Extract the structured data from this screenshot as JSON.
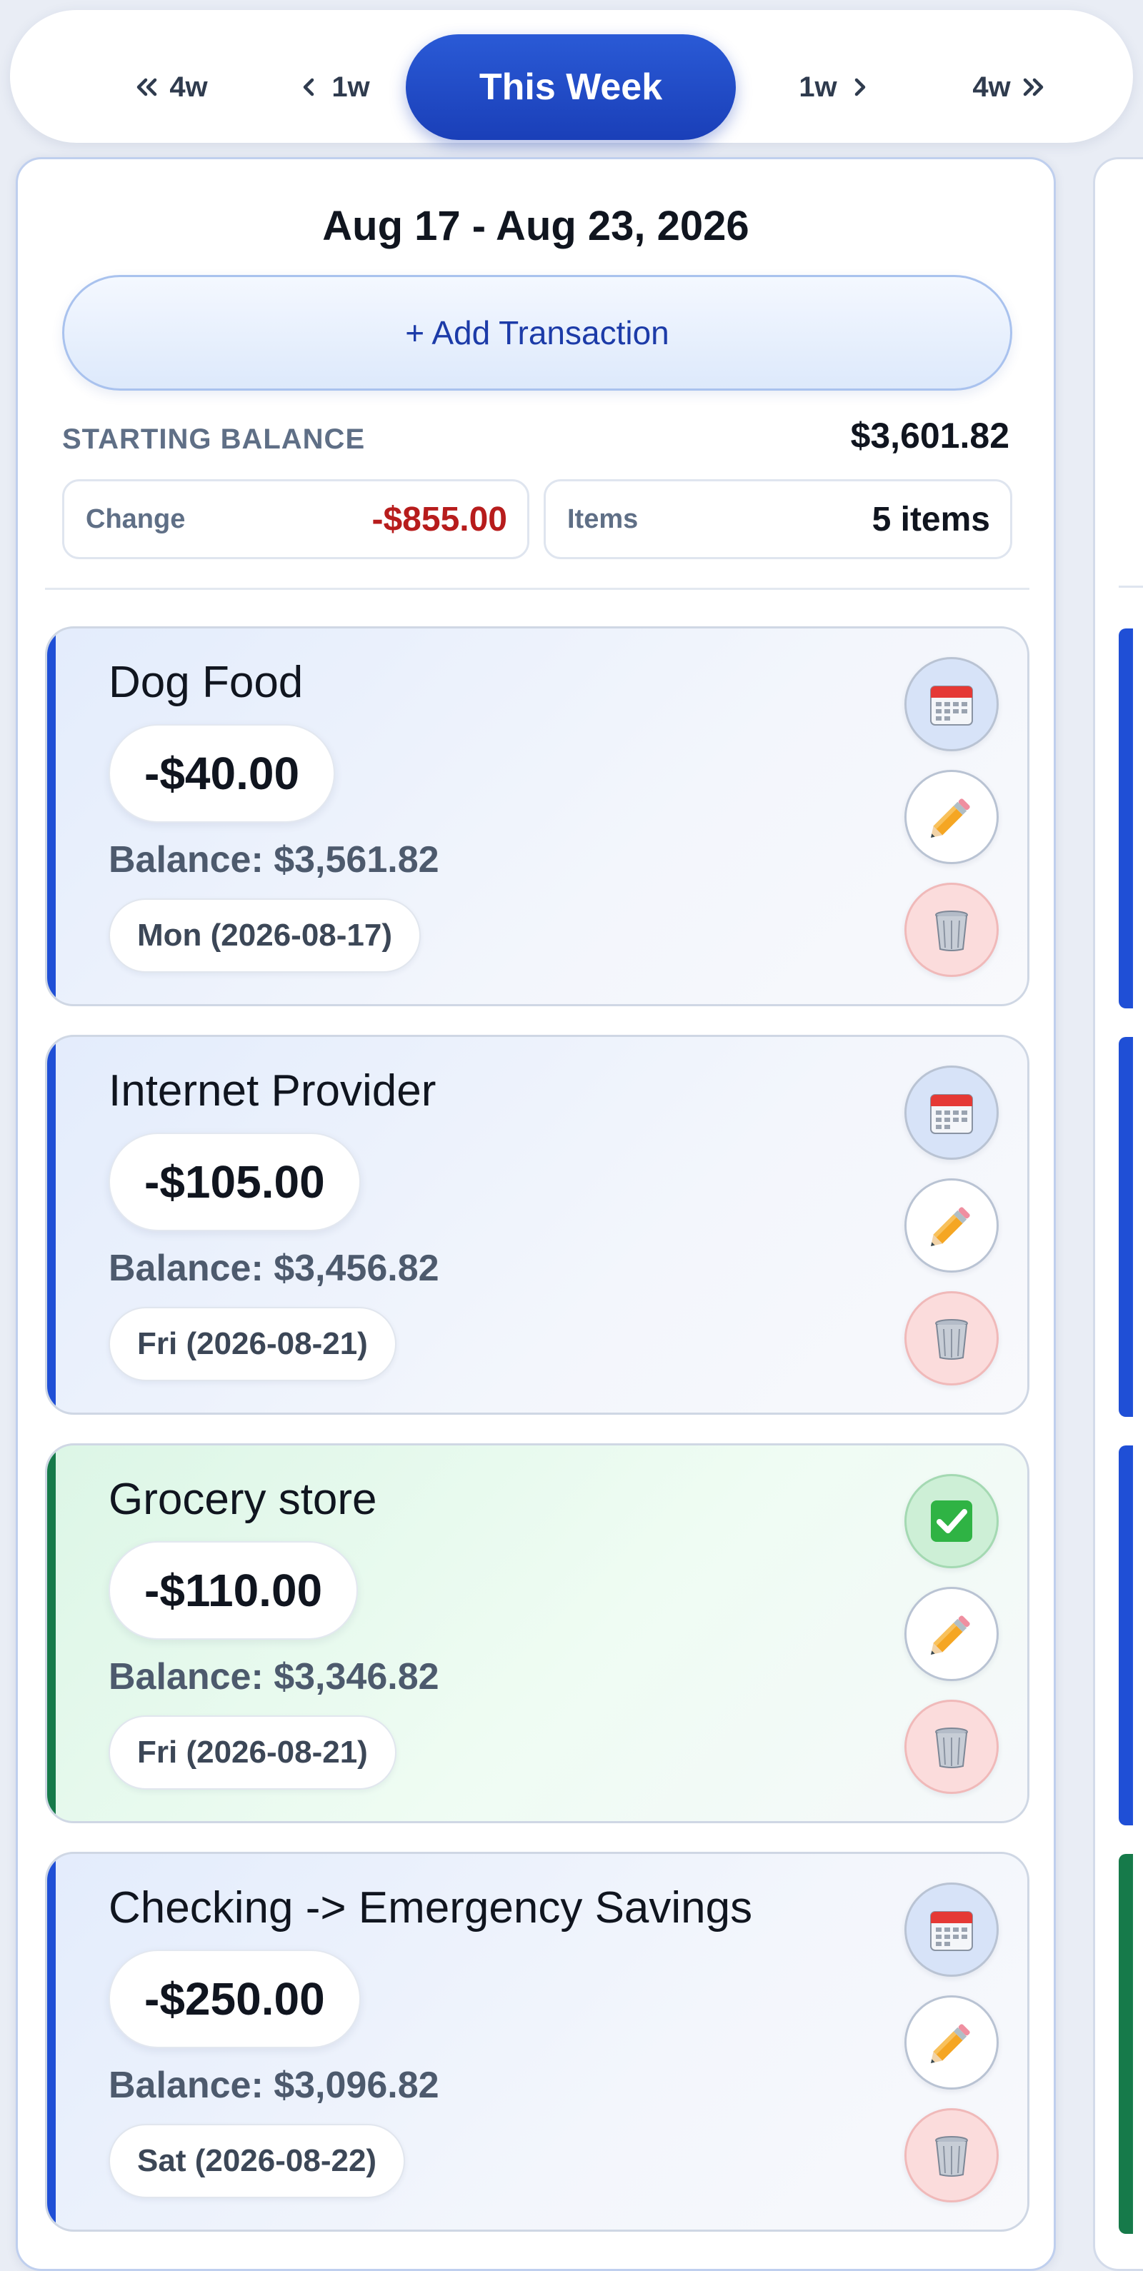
{
  "nav": {
    "back_4w": "4w",
    "back_1w": "1w",
    "current": "This Week",
    "fwd_1w": "1w",
    "fwd_4w": "4w"
  },
  "week": {
    "range": "Aug 17 - Aug 23, 2026",
    "add_label": "+ Add Transaction",
    "starting_label": "STARTING BALANCE",
    "starting_value": "$3,601.82",
    "change_label": "Change",
    "change_value": "-$855.00",
    "items_label": "Items",
    "items_value": "5 items"
  },
  "transactions": [
    {
      "name": "Dog Food",
      "amount": "-$40.00",
      "balance": "Balance: $3,561.82",
      "date": "Mon (2026-08-17)",
      "status": "scheduled"
    },
    {
      "name": "Internet Provider",
      "amount": "-$105.00",
      "balance": "Balance: $3,456.82",
      "date": "Fri (2026-08-21)",
      "status": "scheduled"
    },
    {
      "name": "Grocery store",
      "amount": "-$110.00",
      "balance": "Balance: $3,346.82",
      "date": "Fri (2026-08-21)",
      "status": "completed"
    },
    {
      "name": "Checking -> Emergency Savings",
      "amount": "-$250.00",
      "balance": "Balance: $3,096.82",
      "date": "Sat (2026-08-22)",
      "status": "scheduled"
    }
  ],
  "colors": {
    "accent_scheduled": "#1f4fd6",
    "accent_completed": "#167a4a",
    "negative": "#b71c1c",
    "primary_button": "#1a3fb8"
  },
  "icons": {
    "scheduled": "calendar-icon",
    "completed": "checkmark-icon",
    "edit": "pencil-icon",
    "delete": "trash-icon"
  }
}
